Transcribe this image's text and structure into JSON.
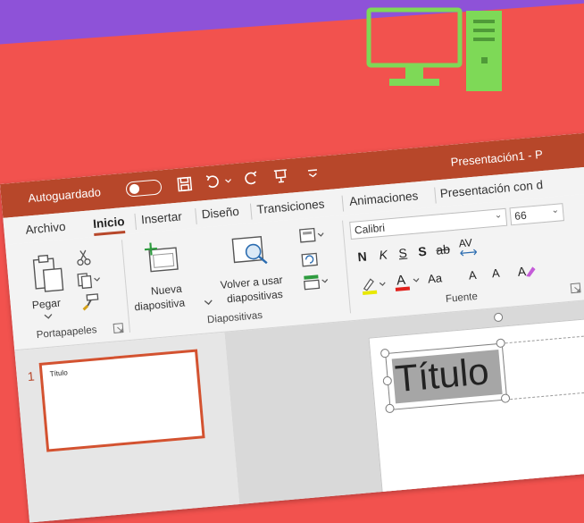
{
  "titlebar": {
    "autosave_label": "Autoguardado",
    "document_title": "Presentación1  -  P"
  },
  "tabs": [
    "Archivo",
    "Inicio",
    "Insertar",
    "Diseño",
    "Transiciones",
    "Animaciones",
    "Presentación con d"
  ],
  "active_tab": "Inicio",
  "ribbon": {
    "portapapeles": {
      "paste_label": "Pegar",
      "group_label": "Portapapeles"
    },
    "diapositivas": {
      "new_slide_line1": "Nueva",
      "new_slide_line2": "diapositiva",
      "reuse_line1": "Volver a usar",
      "reuse_line2": "diapositivas",
      "group_label": "Diapositivas"
    },
    "fuente": {
      "font_name": "Calibri",
      "font_size": "66",
      "bold": "N",
      "italic": "K",
      "underline": "S",
      "shadow": "S",
      "strike": "ab",
      "spacing": "AV",
      "change_case": "Aa",
      "grow": "A",
      "shrink": "A",
      "group_label": "Fuente"
    }
  },
  "slides_panel": {
    "slide_number": "1",
    "thumb_title": "Título"
  },
  "slide": {
    "title_text": "Título"
  },
  "colors": {
    "background": "#f2524e",
    "band": "#8e52d8",
    "accent": "#b7472a",
    "computer": "#7ed957"
  }
}
